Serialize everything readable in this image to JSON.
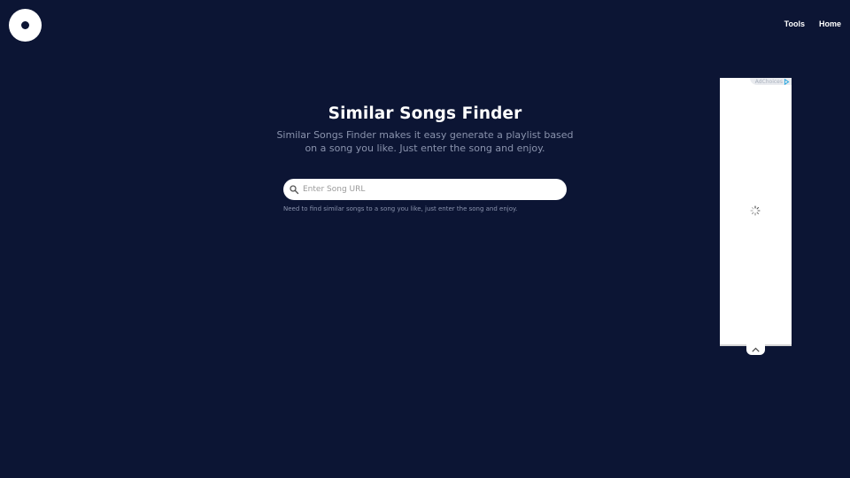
{
  "header": {
    "nav": [
      {
        "label": "Tools"
      },
      {
        "label": "Home"
      }
    ]
  },
  "hero": {
    "title": "Similar Songs Finder",
    "subtitle": "Similar Songs Finder makes it easy generate a playlist based on a song you like. Just enter the song and enjoy."
  },
  "search": {
    "value": "",
    "placeholder": "Enter Song URL",
    "icon": "search-icon"
  },
  "helper_text": "Need to find similar songs to a song you like, just enter the song and enjoy.",
  "ad": {
    "adchoices_label": "AdChoices",
    "icons": [
      "adchoices-icon",
      "loading-spinner-icon",
      "chevron-up-icon"
    ]
  },
  "colors": {
    "background": "#0c1534",
    "text_primary": "#ffffff",
    "text_muted": "#8a93ad",
    "adchoices_blue": "#29a8e0"
  }
}
